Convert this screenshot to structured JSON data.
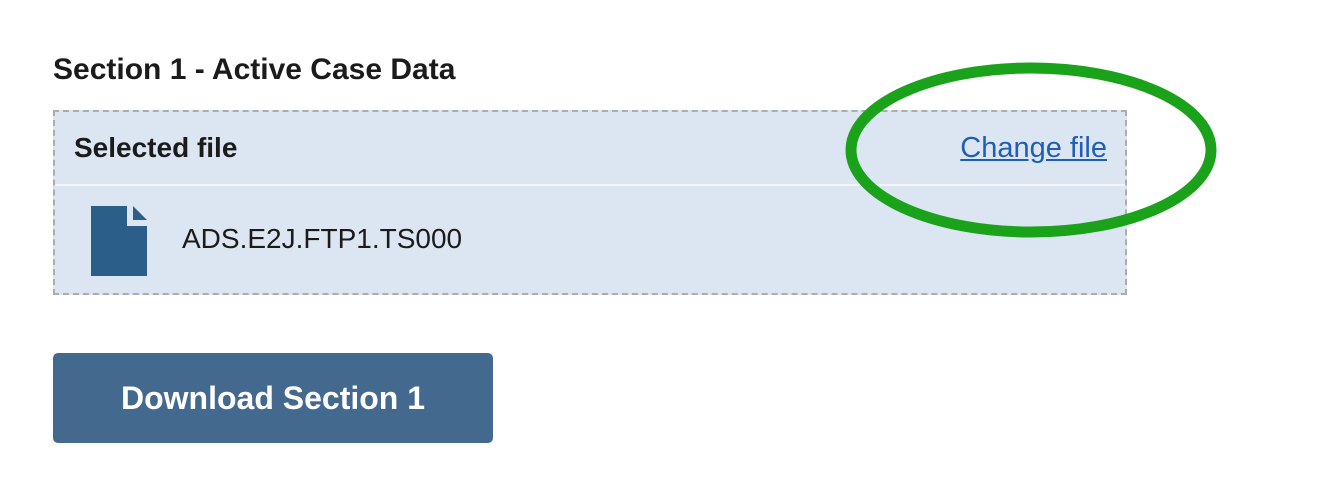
{
  "section": {
    "title": "Section 1 - Active Case Data"
  },
  "file_box": {
    "header_label": "Selected file",
    "change_link": "Change file",
    "file_name": "ADS.E2J.FTP1.TS000",
    "file_icon": "document-icon"
  },
  "actions": {
    "download_label": "Download Section 1"
  },
  "colors": {
    "box_background": "#dce6f2",
    "link": "#1f5eb8",
    "button": "#43698f",
    "file_icon": "#2b5f8a",
    "highlight": "#1aa31a"
  }
}
